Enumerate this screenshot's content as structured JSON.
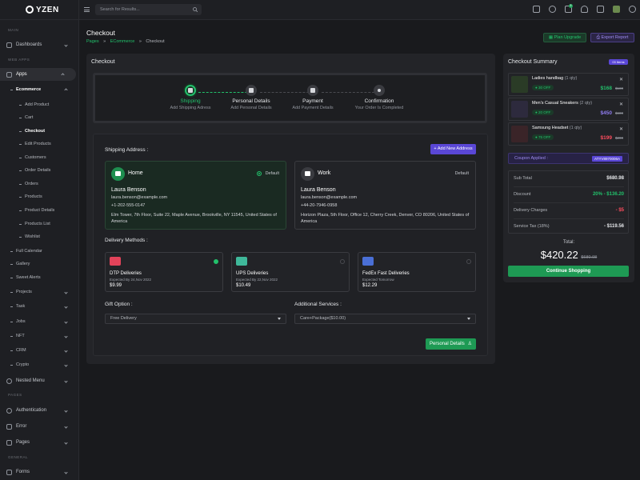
{
  "app": {
    "brand": "YZEN"
  },
  "search": {
    "placeholder": "Search for Results..."
  },
  "topbar": {
    "cart_badge": "5"
  },
  "sidebar": {
    "sections": {
      "main": "MAIN",
      "web_apps": "WEB APPS",
      "pages": "PAGES",
      "general": "GENERAL"
    },
    "items": {
      "dashboards": "Dashboards",
      "apps": "Apps",
      "ecommerce": "Ecommerce",
      "full_calendar": "Full Calendar",
      "gallery": "Gallery",
      "sweet_alerts": "Sweet Alerts",
      "projects": "Projects",
      "task": "Task",
      "jobs": "Jobs",
      "nft": "NFT",
      "crm": "CRM",
      "crypto": "Crypto",
      "nested_menu": "Nested Menu",
      "authentication": "Authentication",
      "error": "Error",
      "pages": "Pages",
      "forms": "Forms"
    },
    "ecommerce_sub": [
      "Add Product",
      "Cart",
      "Checkout",
      "Edit Products",
      "Customers",
      "Order Details",
      "Orders",
      "Products",
      "Product Details",
      "Products List",
      "Wishlist"
    ]
  },
  "header": {
    "title": "Checkout",
    "breadcrumb": {
      "pages": "Pages",
      "ecommerce": "ECommerce",
      "current": "Checkout"
    },
    "plan_upgrade": "Plan Upgrade",
    "export_report": "Export Report"
  },
  "checkout": {
    "title": "Checkout",
    "steps": [
      {
        "title": "Shipping",
        "subtitle": "Add Shipping Adress"
      },
      {
        "title": "Personal Details",
        "subtitle": "Add Personal Details"
      },
      {
        "title": "Payment",
        "subtitle": "Add Payment Details"
      },
      {
        "title": "Confirmation",
        "subtitle": "Your Order Is Completed"
      }
    ],
    "shipping_label": "Shipping Address :",
    "add_address": "Add New Address",
    "addresses": [
      {
        "type": "Home",
        "default_label": "Default",
        "name": "Laura Benson",
        "email": "laura.benson@example.com",
        "phone": "+1-202-555-0147",
        "street": "Elm Tower, 7th Floor, Suite 22, Maple Avenue, Brookville, NY 11545, United States of America"
      },
      {
        "type": "Work",
        "default_label": "Default",
        "name": "Laura Benson",
        "email": "laura.benson@example.com",
        "phone": "+44-20-7946-0958",
        "street": "Horizon Plaza, 5th Floor, Office 12, Cherry Creek, Denver, CO 80206, United States of America"
      }
    ],
    "delivery_label": "Delivery Methods :",
    "delivery": [
      {
        "name": "DTP Deliveries",
        "expected": "Expected By 24,Nov 2022",
        "price": "$9.99"
      },
      {
        "name": "UPS Deliveries",
        "expected": "Expected By 22,Nov 2022",
        "price": "$10.49"
      },
      {
        "name": "FedEx Fast Deliveries",
        "expected": "Expected Tomorrow",
        "price": "$12.29"
      }
    ],
    "gift_label": "Gift Option :",
    "gift_value": "Free Delivery",
    "services_label": "Additional Services :",
    "services_value": "Care+Package($10.00)",
    "next_button": "Personal Details"
  },
  "summary": {
    "title": "Checkout Summary",
    "items_badge": "03 Items",
    "products": [
      {
        "name": "Ladies handbag",
        "qty": "(1 qty)",
        "off": "30 OFF",
        "price": "$168",
        "old": "$180",
        "price_color": "#22c16b"
      },
      {
        "name": "Men's Casual Sneakers",
        "qty": "(2 qty)",
        "off": "20 OFF",
        "price": "$450",
        "old": "$600",
        "price_color": "#8f7cf0"
      },
      {
        "name": "Samsung Headset",
        "qty": "(1 qty)",
        "off": "75 OFF",
        "price": "$199",
        "old": "$200",
        "price_color": "#ff4d5e"
      }
    ],
    "coupon_label": "Coupon Applied :",
    "coupon_code": "ATYV8970006A",
    "rows": [
      {
        "label": "Sub Total",
        "value": "$680.98",
        "color": "#e6e8eb"
      },
      {
        "label": "Discount",
        "value": "20% - $136.20",
        "color": "#22c16b"
      },
      {
        "label": "Delivery Charges",
        "value": "- $5",
        "color": "#ff4d5e"
      },
      {
        "label": "Service Tax (18%)",
        "value": "- $119.56",
        "color": "#e6e8eb"
      }
    ],
    "total_label": "Total:",
    "total": "$420.22",
    "total_old": "$680.98",
    "continue": "Continue Shopping"
  }
}
